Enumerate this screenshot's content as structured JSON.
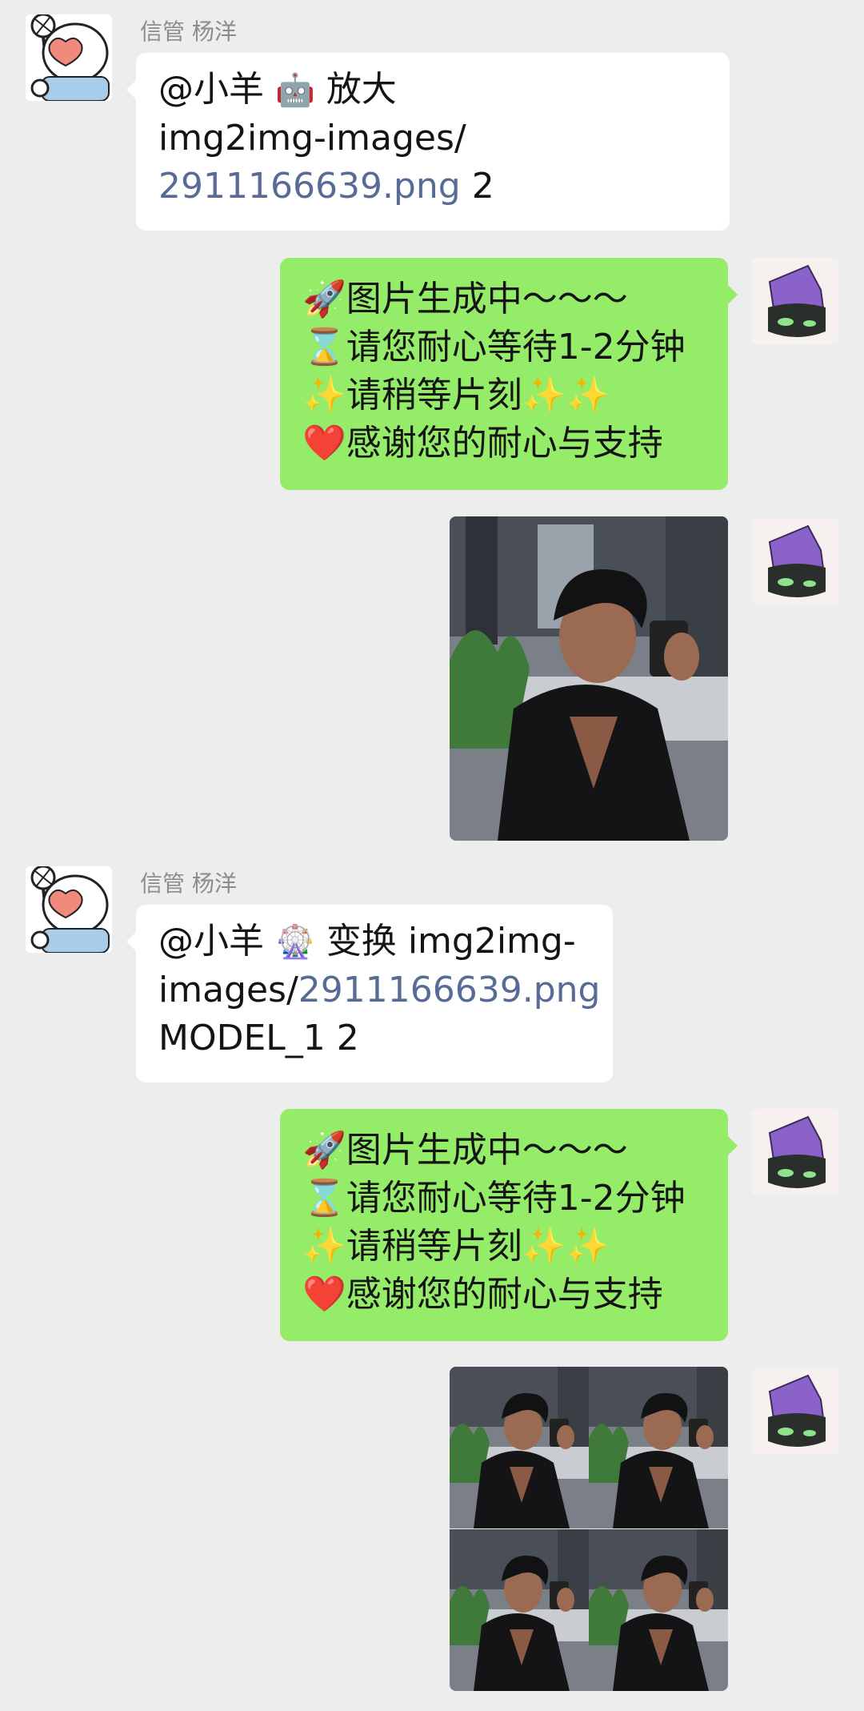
{
  "messages": [
    {
      "sender": "信管 杨洋",
      "mention": "@小羊",
      "emoji": "🤖",
      "command": "放大",
      "line2": "img2img-images/",
      "link": "2911166639.png",
      "tail": "2"
    },
    {
      "lines": [
        "🚀图片生成中～～～",
        "⌛请您耐心等待1-2分钟",
        "✨请稍等片刻✨✨",
        "❤️感谢您的耐心与支持"
      ]
    },
    {
      "image": "generated-portrait"
    },
    {
      "sender": "信管 杨洋",
      "mention": "@小羊",
      "emoji": "🎡",
      "command": "变换",
      "line1_tail": "img2img-",
      "line2": "images/",
      "link": "2911166639.png",
      "line3": "MODEL_1 2"
    },
    {
      "lines": [
        "🚀图片生成中～～～",
        "⌛请您耐心等待1-2分钟",
        "✨请稍等片刻✨✨",
        "❤️感谢您的耐心与支持"
      ]
    },
    {
      "image": "generated-grid-2x2"
    }
  ],
  "icons": {
    "left_avatar": "cartoon-sheep-avatar",
    "right_avatar": "purple-robot-avatar"
  },
  "colors": {
    "background": "#ededed",
    "incoming_bubble": "#ffffff",
    "outgoing_bubble": "#95ec69",
    "link": "#576b95"
  }
}
